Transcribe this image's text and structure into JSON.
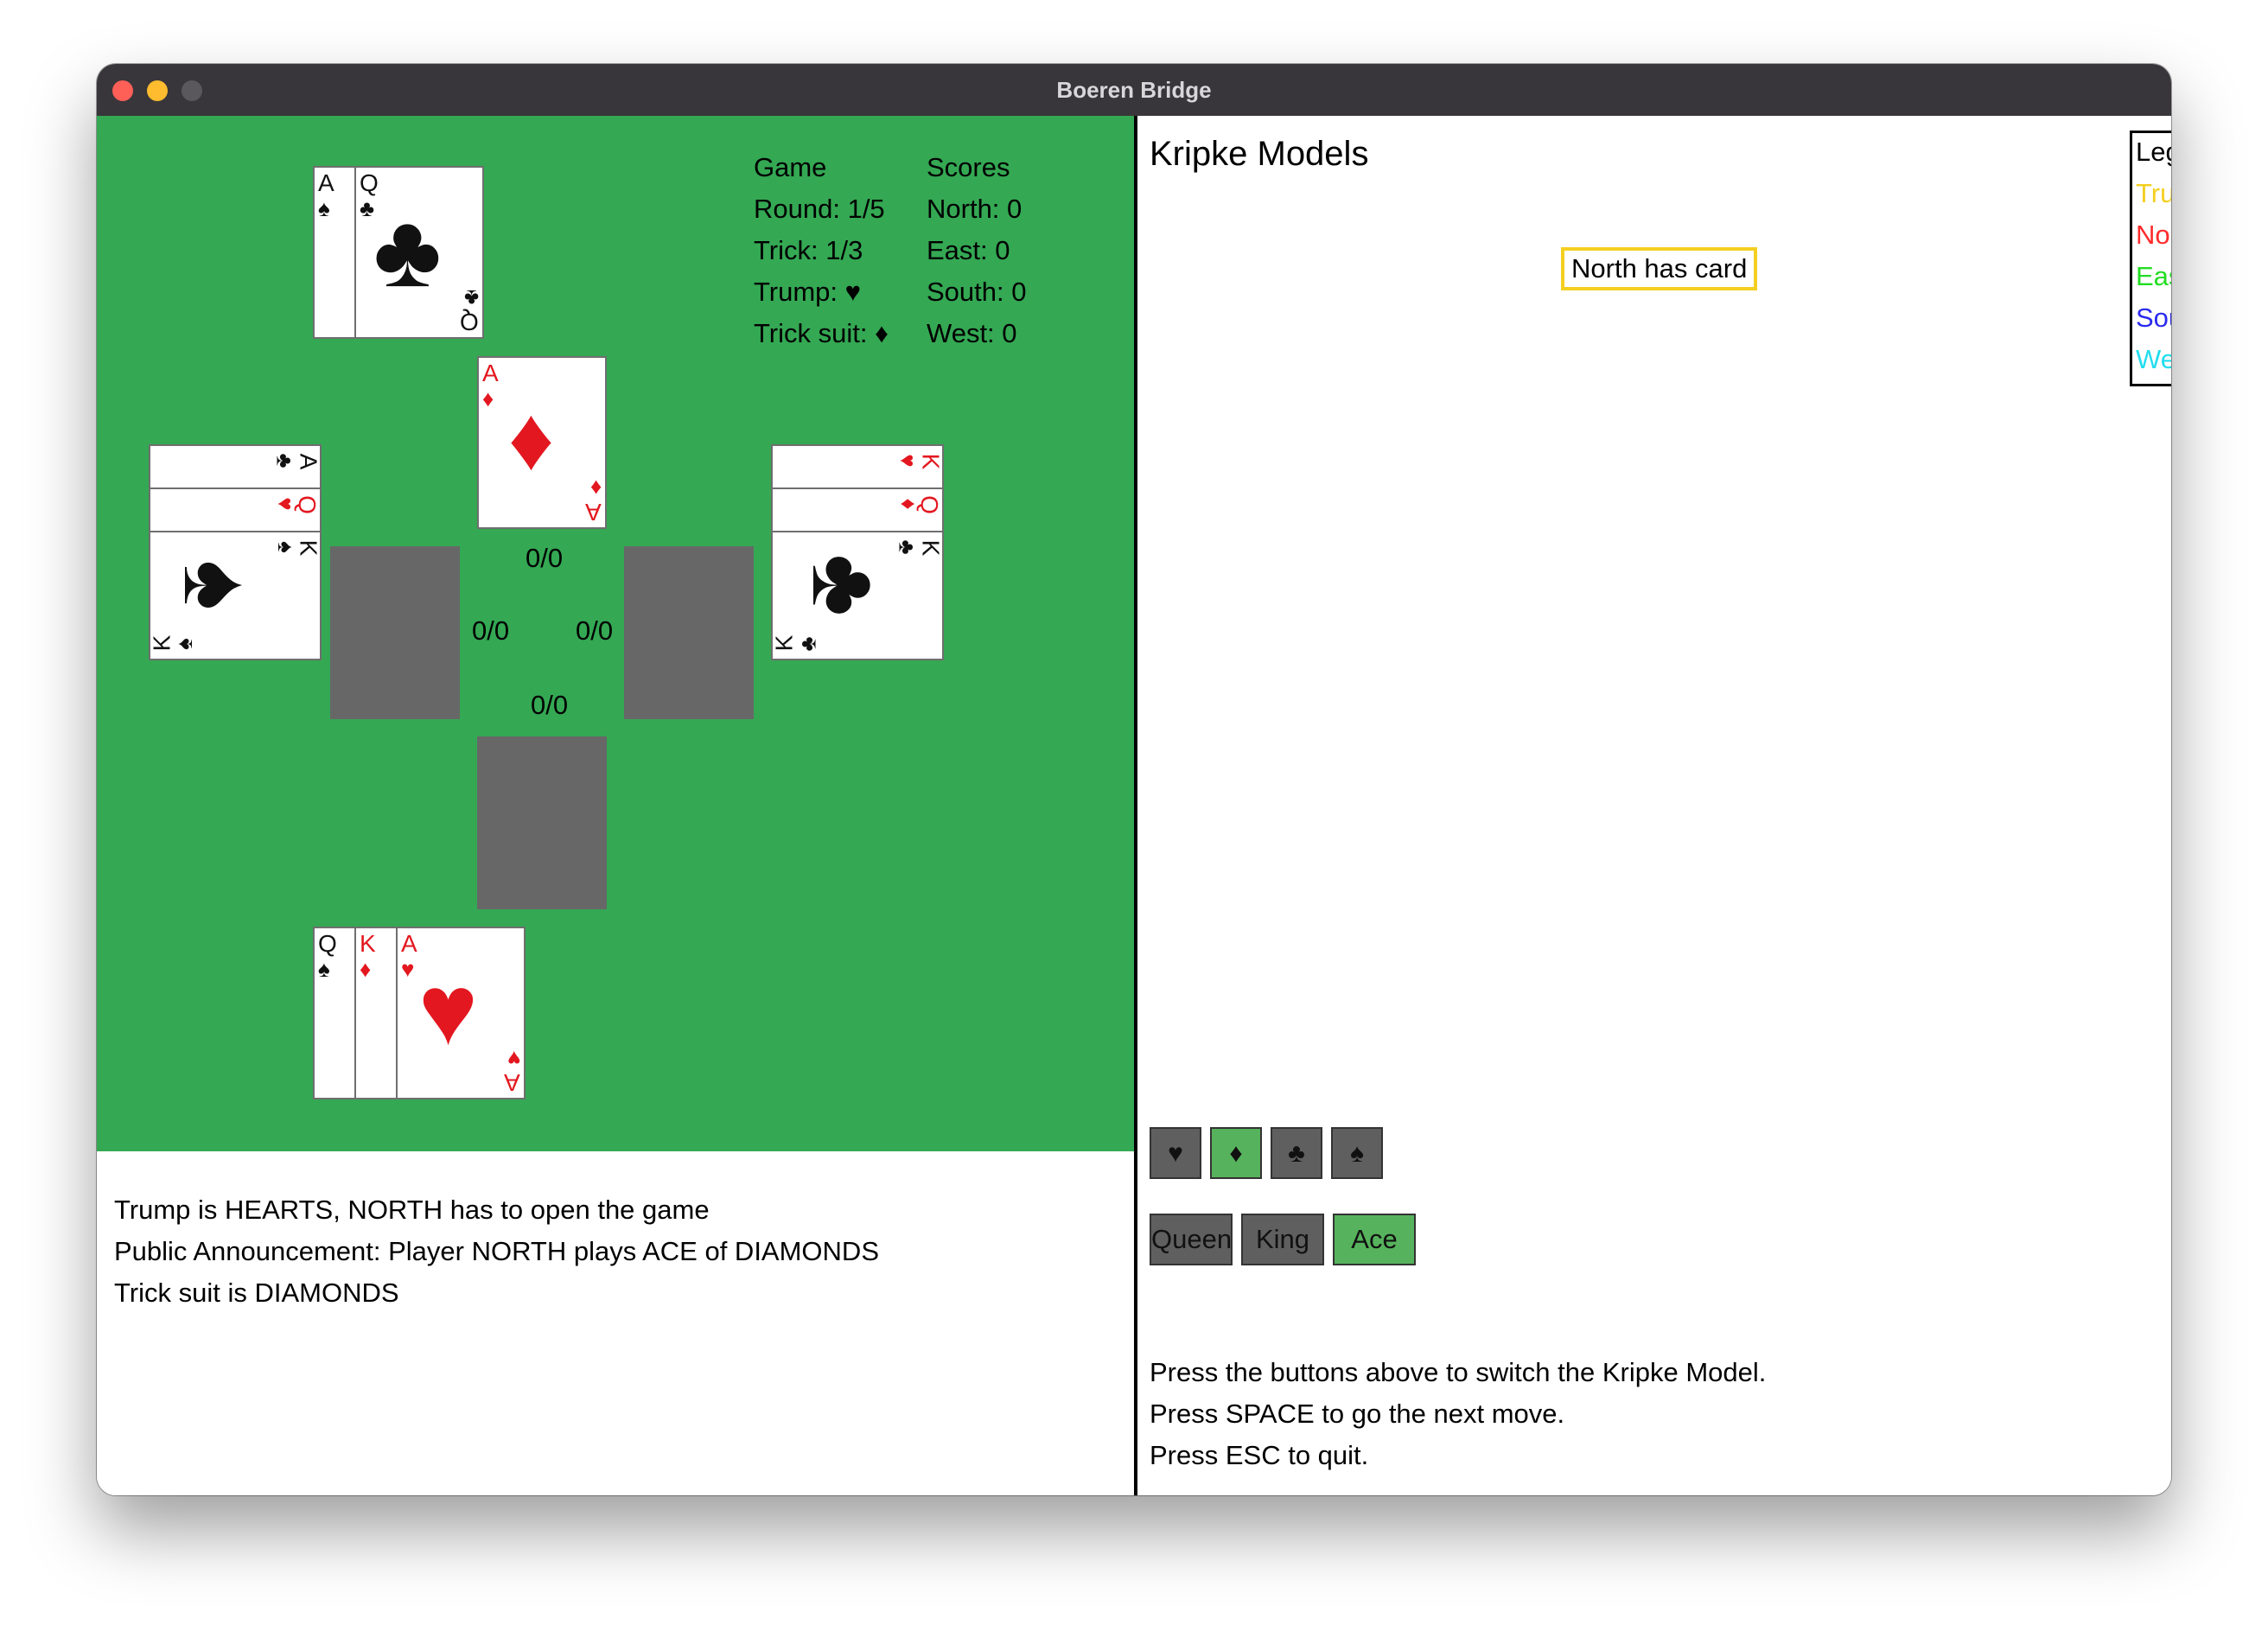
{
  "window": {
    "title": "Boeren Bridge"
  },
  "game_info": {
    "game_header": "Game",
    "round": "Round: 1/5",
    "trick": "Trick: 1/3",
    "trump": "Trump: ♥",
    "trick_suit": "Trick suit: ♦"
  },
  "scores": {
    "header": "Scores",
    "north": "North: 0",
    "east": "East: 0",
    "south": "South: 0",
    "west": "West: 0"
  },
  "hands": {
    "north": [
      {
        "rank": "A",
        "suit": "♠"
      },
      {
        "rank": "Q",
        "suit": "♣"
      }
    ],
    "west": [
      {
        "rank": "A",
        "suit": "♣"
      },
      {
        "rank": "Q",
        "suit": "♥"
      },
      {
        "rank": "K",
        "suit": "♠"
      }
    ],
    "east": [
      {
        "rank": "K",
        "suit": "♥"
      },
      {
        "rank": "Q",
        "suit": "♦"
      },
      {
        "rank": "K",
        "suit": "♣"
      }
    ],
    "south": [
      {
        "rank": "Q",
        "suit": "♠"
      },
      {
        "rank": "K",
        "suit": "♦"
      },
      {
        "rank": "A",
        "suit": "♥"
      }
    ]
  },
  "played": {
    "north": {
      "rank": "A",
      "suit": "♦"
    }
  },
  "tricks": {
    "north": "0/0",
    "west": "0/0",
    "east": "0/0",
    "south": "0/0"
  },
  "log": [
    "Trump is HEARTS, NORTH has to open the game",
    "Public Announcement: Player NORTH plays ACE of DIAMONDS",
    "Trick suit is DIAMONDS"
  ],
  "kripke": {
    "title": "Kripke Models",
    "callout": "North has card",
    "legend": {
      "title": "Legend:",
      "items": [
        {
          "label": "True world □",
          "color": "#f4cf20"
        },
        {
          "label": "North",
          "color": "#ff2b2b"
        },
        {
          "label": "East",
          "color": "#22dd22"
        },
        {
          "label": "South",
          "color": "#2a2aee"
        },
        {
          "label": "West",
          "color": "#22ddee"
        }
      ]
    },
    "suit_buttons": [
      {
        "symbol": "♥",
        "active": false
      },
      {
        "symbol": "♦",
        "active": true
      },
      {
        "symbol": "♣",
        "active": false
      },
      {
        "symbol": "♠",
        "active": false
      }
    ],
    "rank_buttons": [
      {
        "label": "Queen",
        "active": false
      },
      {
        "label": "King",
        "active": false
      },
      {
        "label": "Ace",
        "active": true
      }
    ],
    "instructions": [
      "Press the buttons above to switch the Kripke Model.",
      "Press SPACE to go the next move.",
      "Press ESC to quit."
    ]
  },
  "colors": {
    "board": "#34a853",
    "active_button": "#56b25c",
    "inactive_button": "#5f5f5f",
    "slot": "#676767"
  }
}
